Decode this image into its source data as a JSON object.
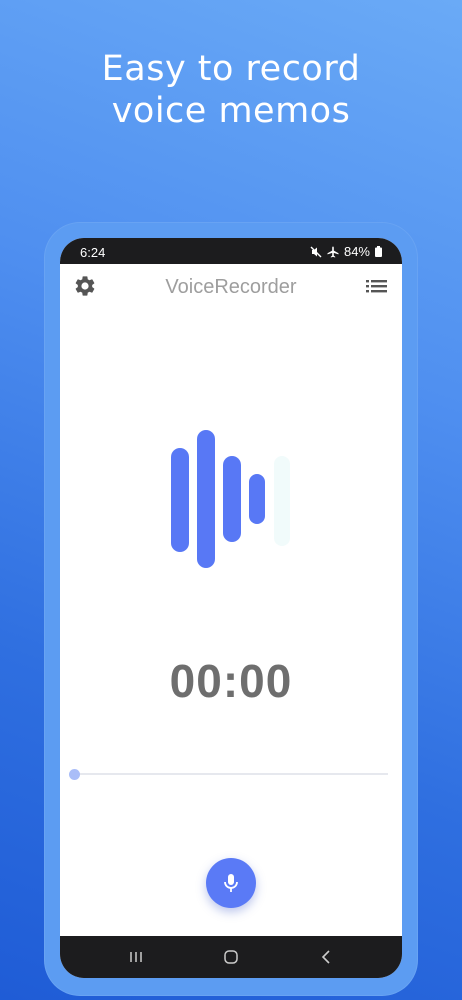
{
  "promo": {
    "headline_line1": "Easy to record",
    "headline_line2": "voice memos"
  },
  "statusbar": {
    "time": "6:24",
    "battery": "84%",
    "icons": [
      "mute-icon",
      "airplane-icon",
      "battery-icon"
    ]
  },
  "appbar": {
    "title": "VoiceRecorder",
    "left_icon": "gear-icon",
    "right_icon": "list-icon"
  },
  "recorder": {
    "timer": "00:00",
    "progress": 0,
    "record_icon": "microphone-icon"
  },
  "navbar": {
    "buttons": [
      "recent-apps-icon",
      "home-icon",
      "back-icon"
    ]
  },
  "colors": {
    "accent": "#5a7af6",
    "logo_bars": "#5878f5",
    "background_top": "#6aaaf6",
    "background_bottom": "#1f5cd6",
    "title_gray": "#9e9e9e",
    "timer_gray": "#6e6e6e"
  }
}
